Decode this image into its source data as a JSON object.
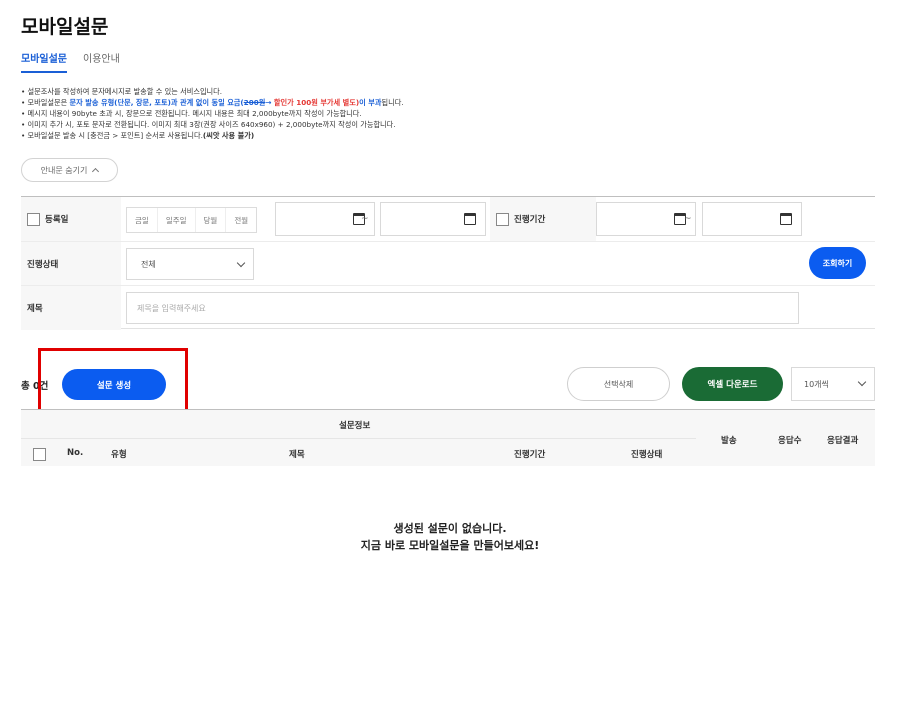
{
  "page": {
    "title": "모바일설문"
  },
  "tabs": [
    {
      "label": "모바일설문",
      "active": true
    },
    {
      "label": "이용안내",
      "active": false
    }
  ],
  "notice": {
    "line1": "설문조사를 작성하여 문자메시지로 발송할 수 있는 서비스입니다.",
    "line2_prefix": "모바일설문은 ",
    "line2_blue1": "문자 발송 유형(단문, 장문, 포토)과 관계 없이 동일 요금(",
    "line2_strike": "200원",
    "line2_arrow": "→ ",
    "line2_red": "할인가 100원 부가세 별도)",
    "line2_blue2": "이 부과",
    "line2_suffix": "됩니다.",
    "line3": "메시지 내용이 90byte 초과 시, 장문으로 전환됩니다. 메시지 내용은 최대 2,000byte까지 작성이 가능합니다.",
    "line4": "이미지 추가 시, 포토 문자로 전환됩니다. 이미지 최대 3장(권장 사이즈 640x960) + 2,000byte까지 작성이 가능합니다.",
    "line5_prefix": "모바일설문 발송 시 [충전금 > 포인트] 순서로 사용됩니다.",
    "line5_bold": "(씨앗 사용 불가)",
    "hide_label": "안내문 숨기기"
  },
  "filter": {
    "reg_date_label": "등록일",
    "quick_ranges": [
      "금일",
      "일주일",
      "당월",
      "전월"
    ],
    "tilde": "~",
    "period_label": "진행기간",
    "status_label": "진행상태",
    "status_value": "전체",
    "title_label": "제목",
    "title_placeholder": "제목을 입력해주세요",
    "search_label": "조회하기"
  },
  "toolbar": {
    "total": "총 0건",
    "create_label": "설문 생성",
    "delete_label": "선택삭제",
    "excel_label": "엑셀 다운로드",
    "per_page": "10개씩"
  },
  "table": {
    "group_header": "설문정보",
    "columns": [
      "No.",
      "유형",
      "제목",
      "진행기간",
      "진행상태",
      "발송",
      "응답수",
      "응답결과"
    ]
  },
  "empty": {
    "line1": "생성된 설문이 없습니다.",
    "line2": "지금 바로 모바일설문을 만들어보세요!"
  },
  "colors": {
    "primary": "#0b5cf0",
    "excel": "#1a6b35",
    "highlight": "#e00000"
  }
}
